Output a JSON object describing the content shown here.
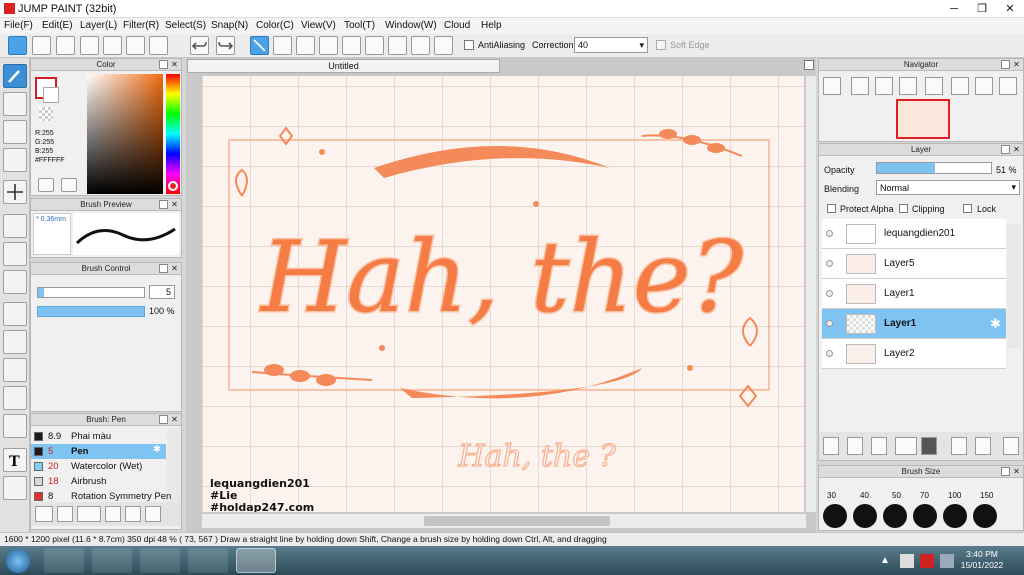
{
  "app": {
    "title": "JUMP PAINT (32bit)"
  },
  "menu": [
    "File(F)",
    "Edit(E)",
    "Layer(L)",
    "Filter(R)",
    "Select(S)",
    "Snap(N)",
    "Color(C)",
    "View(V)",
    "Tool(T)",
    "Window(W)",
    "Cloud",
    "Help"
  ],
  "toolbar": {
    "antialiasing": "AntiAliasing",
    "correction_label": "Correction",
    "correction_value": "40",
    "soft_edge": "Soft Edge"
  },
  "color_panel": {
    "title": "Color",
    "r": "R:255",
    "g": "G:255",
    "b": "B:255",
    "hex": "#FFFFFF"
  },
  "brush_preview": {
    "title": "Brush Preview",
    "size": "* 0.36mm"
  },
  "brush_control": {
    "title": "Brush Control",
    "size_value": "5",
    "opacity_value": "100 %"
  },
  "brush_list": {
    "title": "Brush: Pen",
    "items": [
      {
        "size": "8.9",
        "name": "Phai màu",
        "color": "#1a1a1a"
      },
      {
        "size": "5",
        "name": "Pen",
        "color": "#1a1a1a"
      },
      {
        "size": "20",
        "name": "Watercolor (Wet)",
        "color": "#7fd0f0"
      },
      {
        "size": "18",
        "name": "Airbrush",
        "color": "#d8d8d8"
      },
      {
        "size": "8",
        "name": "Rotation Symmetry Pen",
        "color": "#e03030"
      }
    ]
  },
  "document": {
    "tab": "Untitled"
  },
  "artwork": {
    "main_text": "Hah, the?",
    "small_text": "Hah, the ?",
    "credit1": "lequangdien201",
    "credit2": "#Lie",
    "credit3": "#holdap247.com"
  },
  "navigator": {
    "title": "Navigator"
  },
  "layer_panel": {
    "title": "Layer",
    "opacity_label": "Opacity",
    "opacity_value": "51 %",
    "opacity_fraction": 0.51,
    "blending_label": "Blending",
    "blending_value": "Normal",
    "protect_alpha": "Protect Alpha",
    "clipping": "Clipping",
    "lock": "Lock",
    "layers": [
      "lequangdien201",
      "Layer5",
      "Layer1",
      "Layer1",
      "Layer2"
    ]
  },
  "brush_size": {
    "title": "Brush Size",
    "values": [
      "30",
      "40",
      "50",
      "70",
      "100",
      "150"
    ]
  },
  "status": "1600 * 1200 pixel   (11.6 * 8.7cm)   350 dpi   48 %   ( 73, 567 )   Draw a straight line by holding down Shift, Change a brush size by holding down Ctrl, Alt, and dragging",
  "taskbar": {
    "time": "3:40 PM",
    "date": "15/01/2022"
  },
  "colors": {
    "accent": "#3b8fd6",
    "art_orange": "#f4895a",
    "selected_layer": "#7fc3f2"
  }
}
